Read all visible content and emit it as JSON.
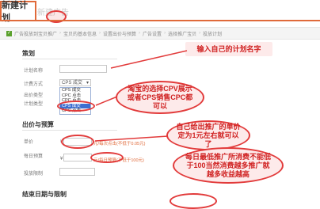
{
  "tabs": {
    "active": "新建计划",
    "inactive": "新建广告"
  },
  "steps": {
    "items": [
      "广告投放到宝贝推广",
      "宝贝的基本信息",
      "设置出价与预算",
      "广告设置",
      "选择推广宝贝",
      "投放计划"
    ]
  },
  "form": {
    "basic_title": "策划",
    "plan_name_label": "计划名称",
    "charge_mode_label": "计费方式",
    "charge_mode_value": "CPS 成交",
    "bid_label": "出价类型",
    "budget_type_label": "计划类型",
    "dropdown_options": [
      "CPS 成交",
      "CPC 点击",
      "CPC 点击",
      "CPS 成交",
      "CPC 点击"
    ],
    "dropdown_selected_index": 3,
    "bid_section_title": "出价与预算",
    "unit_price_label": "单价",
    "unit_price_prefix": "¥",
    "unit_price_hint": "元/每次点击(不低于0.05元)",
    "daily_budget_label": "每日预算",
    "daily_budget_prefix": "¥",
    "daily_budget_hint": "元/每日预算(不低于100元)",
    "target_label": "投放限制",
    "end_section_title": "结束日期与限制"
  },
  "annotations": {
    "plan_name_tip": "输入自己的计划名字",
    "charge_mode_tip": "淘宝的选择CPV展示或者CPS销售CPC都可以",
    "unit_price_tip": "自己给出推广的单价定为1元左右就可以了",
    "budget_tip": "每日最低推广所消费不能低于100当然消费越多推广就越多收益越高"
  },
  "colors": {
    "accent": "#e06a3a",
    "annotation": "#e23b3b",
    "dropdown_highlight": "#3d6fd1"
  }
}
